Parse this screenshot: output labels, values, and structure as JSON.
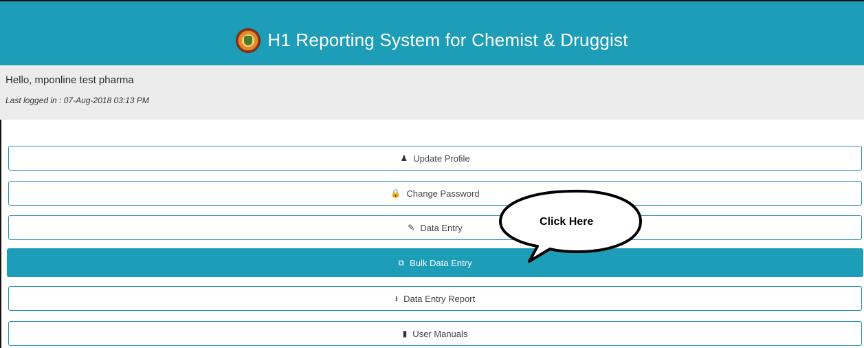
{
  "header": {
    "title": "H1 Reporting System for Chemist & Druggist",
    "logo_icon": "emblem-logo-icon",
    "background": "#1e9db8"
  },
  "user": {
    "greeting": "Hello, mponline test pharma",
    "last_logged": "Last logged in : 07-Aug-2018 03:13 PM"
  },
  "menu": {
    "items": [
      {
        "label": "Update Profile",
        "icon": "user-icon",
        "glyph": "♟",
        "active": false
      },
      {
        "label": "Change Password",
        "icon": "lock-icon",
        "glyph": "🔒",
        "active": false
      },
      {
        "label": "Data Entry",
        "icon": "edit-icon",
        "glyph": "✎",
        "active": false
      },
      {
        "label": "Bulk Data Entry",
        "icon": "copy-icon",
        "glyph": "⧉",
        "active": true
      },
      {
        "label": "Data Entry Report",
        "icon": "download-icon",
        "glyph": "⭳",
        "active": false
      },
      {
        "label": "User Manuals",
        "icon": "book-icon",
        "glyph": "▮",
        "active": false
      }
    ],
    "accent": "#2a8fb0"
  },
  "annotation": {
    "callout_text": "Click Here"
  }
}
